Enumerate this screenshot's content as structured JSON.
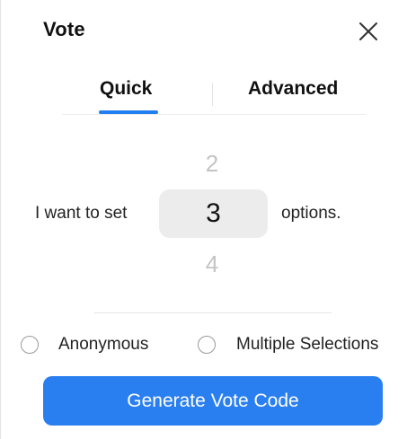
{
  "dialog": {
    "title": "Vote"
  },
  "tabs": [
    {
      "label": "Quick",
      "active": true
    },
    {
      "label": "Advanced",
      "active": false
    }
  ],
  "picker": {
    "prefix": "I want to set",
    "previous": "2",
    "value": "3",
    "next": "4",
    "suffix": "options."
  },
  "options": {
    "anonymous": {
      "label": "Anonymous",
      "checked": false
    },
    "multiple": {
      "label": "Multiple Selections",
      "checked": false
    }
  },
  "generate": {
    "label": "Generate Vote Code"
  },
  "colors": {
    "accent": "#1f7ef0",
    "button": "#2a7ff0",
    "picker_bg": "#ececec"
  },
  "icons": {
    "close": "close-icon"
  }
}
